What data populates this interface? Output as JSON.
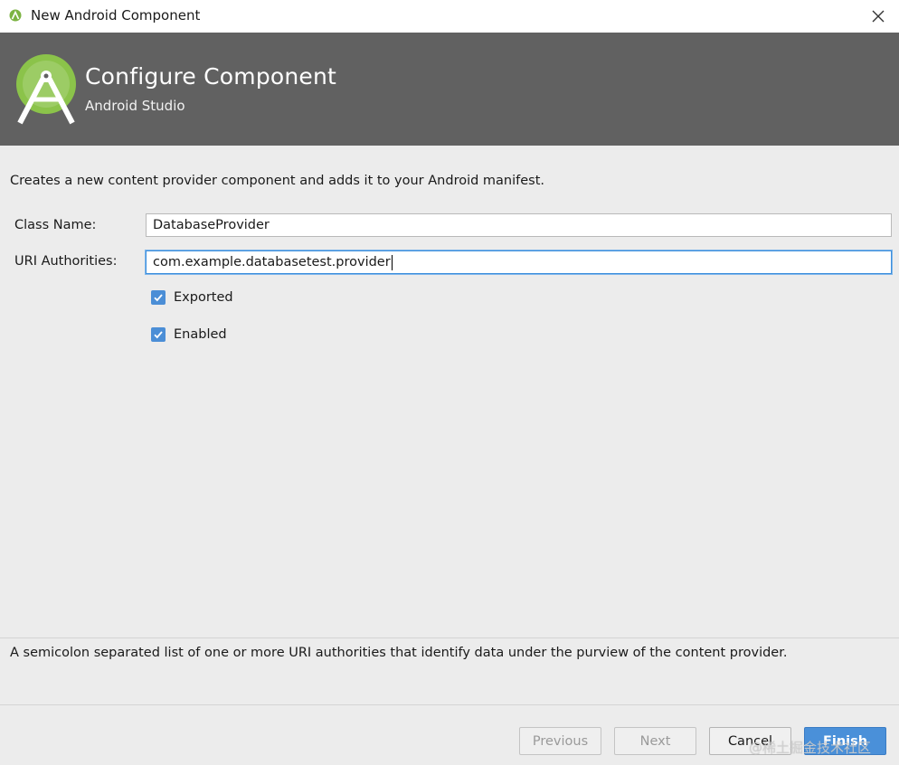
{
  "window": {
    "title": "New Android Component",
    "icon": "android-studio-icon",
    "close_icon": "close-icon"
  },
  "banner": {
    "heading": "Configure Component",
    "subheading": "Android Studio",
    "logo": "android-studio-logo",
    "background": "#616161"
  },
  "description": "Creates a new content provider component and adds it to your Android manifest.",
  "form": {
    "class_name_label": "Class Name:",
    "class_name_value": "DatabaseProvider",
    "uri_label": "URI Authorities:",
    "uri_value": "com.example.databasetest.provider",
    "exported_label": "Exported",
    "exported_checked": true,
    "enabled_label": "Enabled",
    "enabled_checked": true
  },
  "help_text": "A semicolon separated list of one or more URI authorities that identify data under the purview of the content provider.",
  "buttons": {
    "previous": "Previous",
    "next": "Next",
    "cancel": "Cancel",
    "finish": "Finish"
  },
  "watermark": "@稀土掘金技术社区",
  "colors": {
    "accent": "#4a90d9",
    "android_green": "#8bc34a"
  }
}
